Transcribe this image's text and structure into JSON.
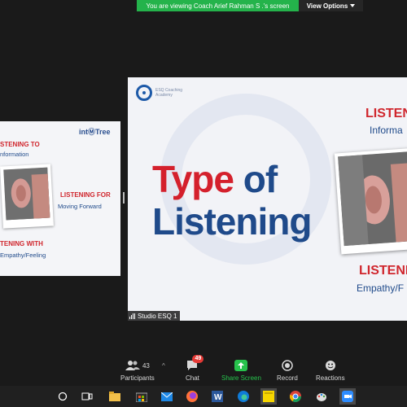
{
  "banner": {
    "message": "You are viewing Coach Arief Rahman S .'s screen",
    "view_options": "View Options"
  },
  "left_tile": {
    "brand": "intⓂTree",
    "item1_title": "STENING TO",
    "item1_sub": "nformation",
    "item2_title": "LISTENING FOR",
    "item2_sub": "Moving Forward",
    "item3_title": "TENING WITH",
    "item3_sub": "Empathy/Feeling"
  },
  "main_screen": {
    "logo_line1": "ESQ Coaching",
    "logo_line2": "Academy",
    "title_word1": "Type",
    "title_word2": "of",
    "title_line2": "Listening",
    "r1_title": "LISTENING",
    "r1_sub": "Informa",
    "r2_title": "LISTENIN",
    "r2_sub": "Empathy/F",
    "presenter_label": "Studio ESQ 1"
  },
  "controls": {
    "participants_label": "Participants",
    "participants_count": "43",
    "chat_label": "Chat",
    "chat_badge": "49",
    "share_label": "Share Screen",
    "record_label": "Record",
    "reactions_label": "Reactions"
  },
  "taskbar": {
    "icons": [
      "search-circle",
      "task-view",
      "file-explorer",
      "store",
      "mail",
      "firefox",
      "word",
      "edge",
      "sticky-notes",
      "chrome",
      "paint",
      "zoom"
    ]
  },
  "colors": {
    "banner_green": "#24b34b",
    "brand_red": "#d4202c",
    "brand_blue": "#1f4a8a",
    "share_green": "#27c24c"
  }
}
